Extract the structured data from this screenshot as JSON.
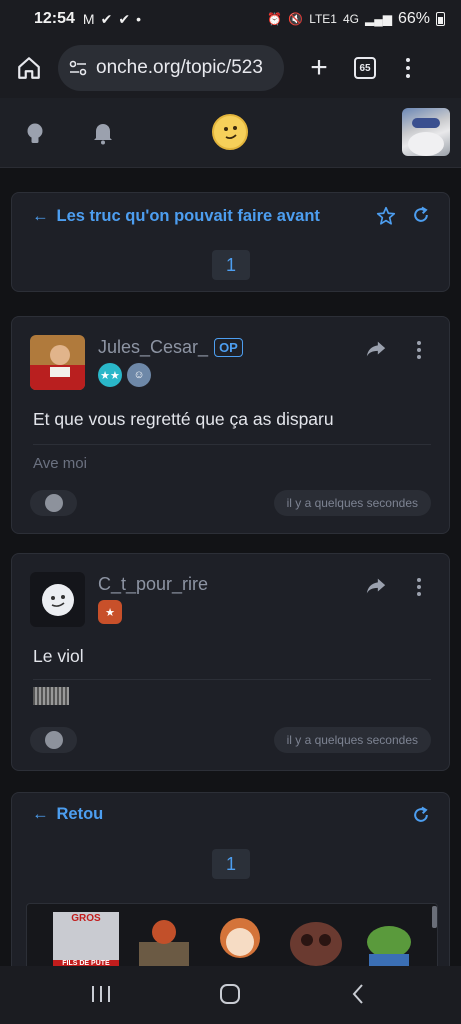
{
  "status": {
    "time": "12:54",
    "network": "4G",
    "carrier": "LTE1",
    "battery": "66%"
  },
  "browser": {
    "url": "onche.org/topic/523",
    "tab_count": "65"
  },
  "topic": {
    "title": "Les truc qu'on pouvait faire avant",
    "page": "1"
  },
  "posts": [
    {
      "username": "Jules_Cesar_",
      "op_label": "OP",
      "text": "Et que vous regretté que ça as disparu",
      "signature": "Ave moi",
      "time": "il y a quelques secondes"
    },
    {
      "username": "C_t_pour_rire",
      "text": "Le viol",
      "time": "il y a quelques secondes"
    }
  ],
  "reply": {
    "back_label": "Retou",
    "page": "1",
    "sticker_text_top": "GROS",
    "sticker_text_bottom": "FILS DE PUTE"
  },
  "colors": {
    "accent": "#4d9ef0",
    "background": "#121316",
    "card": "#1e2027"
  }
}
